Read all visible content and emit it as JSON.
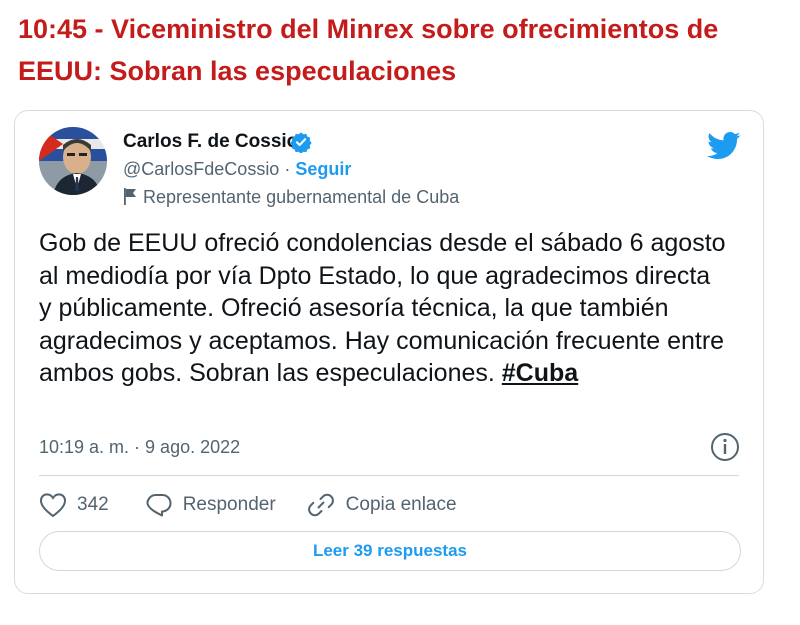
{
  "headline": "10:45 - Viceministro del Minrex sobre ofrecimientos de EEUU: Sobran las especulaciones",
  "tweet": {
    "author_name": "Carlos F. de Cossio",
    "handle": "@CarlosFdeCossio",
    "separator": " · ",
    "follow_label": "Seguir",
    "account_label": "Representante gubernamental de Cuba",
    "text_before_hashtag": "Gob de EEUU ofreció condolencias desde el sábado 6 agosto al mediodía por vía  Dpto Estado, lo que agradecimos directa y públicamente. Ofreció asesoría técnica, la que también agradecimos y aceptamos. Hay comunicación frecuente entre ambos gobs. Sobran las especulaciones. ",
    "hashtag": "#Cuba",
    "timestamp": "10:19 a. m. · 9 ago. 2022",
    "like_count": "342",
    "reply_label": "Responder",
    "copy_link_label": "Copia enlace",
    "read_replies_label": "Leer 39 respuestas"
  },
  "icons": {
    "verified": "verified-badge-icon",
    "twitter": "twitter-bird-icon",
    "flag": "flag-icon",
    "info": "info-icon",
    "like": "heart-icon",
    "reply": "speech-bubble-icon",
    "link": "link-icon"
  },
  "colors": {
    "headline": "#c41b1b",
    "twitter_blue": "#1d9bf0",
    "secondary_text": "#536471",
    "border": "#cfd9de"
  }
}
